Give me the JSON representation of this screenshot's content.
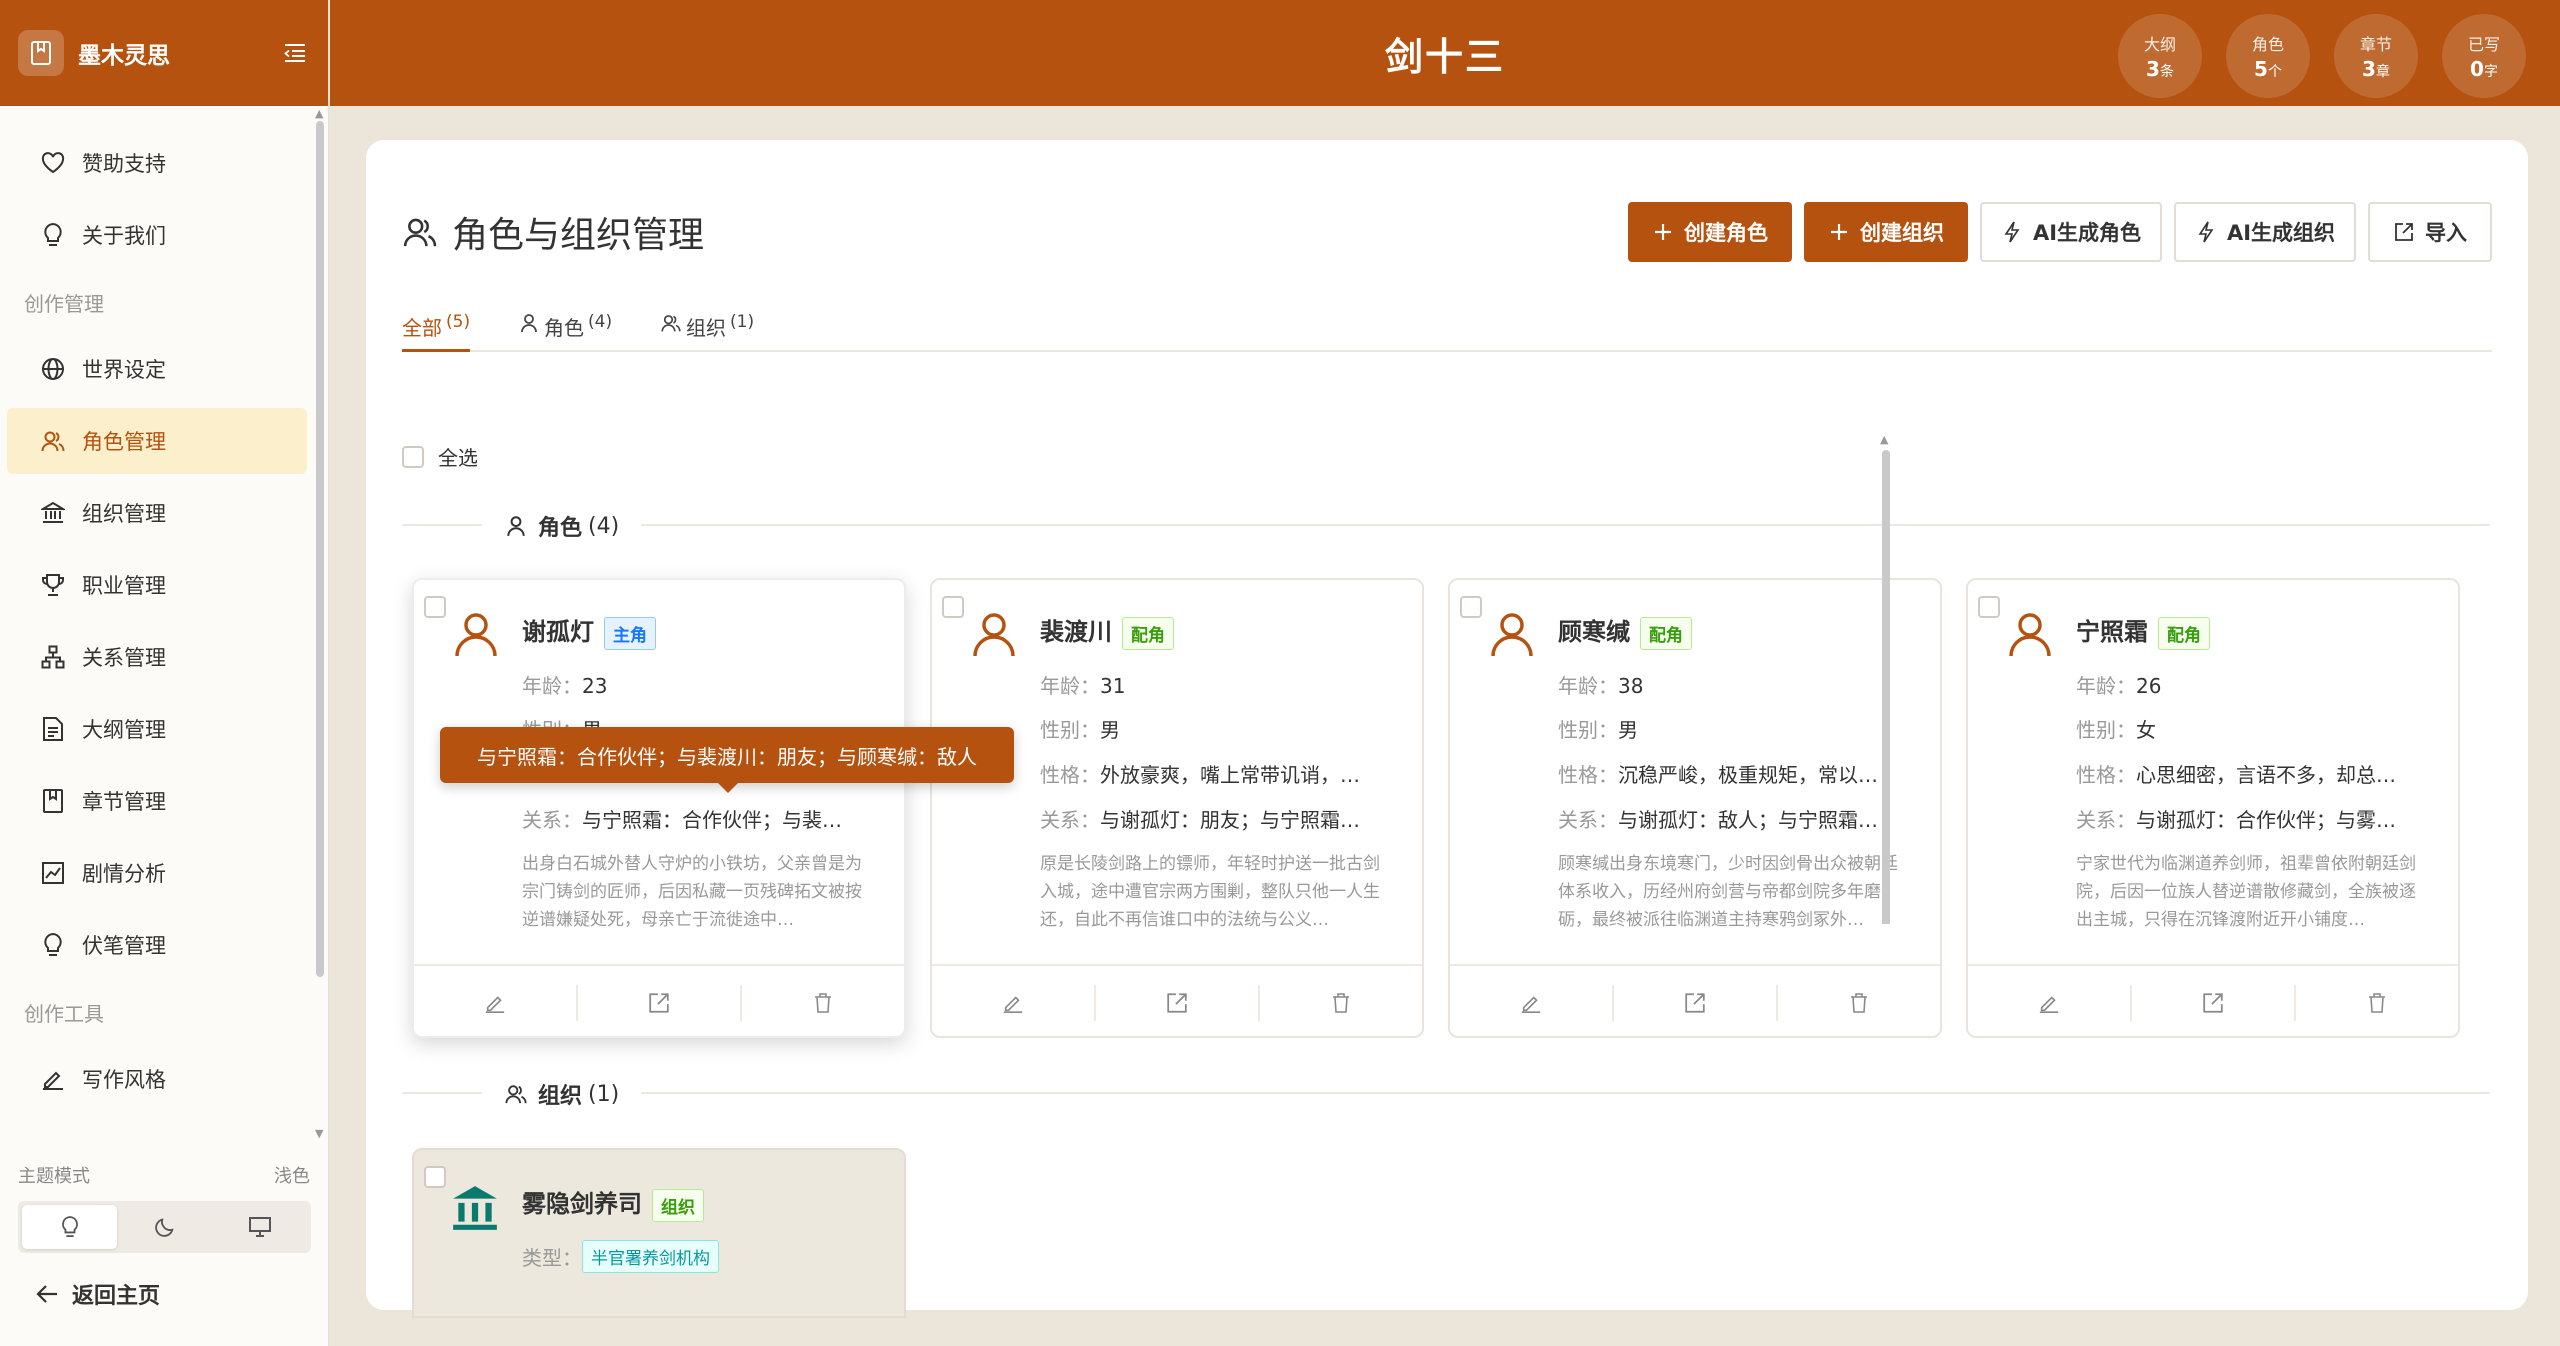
{
  "brand": {
    "name": "墨木灵思"
  },
  "header": {
    "title": "剑十三",
    "stats": [
      {
        "label": "大纲",
        "value": "3",
        "unit": "条"
      },
      {
        "label": "角色",
        "value": "5",
        "unit": "个"
      },
      {
        "label": "章节",
        "value": "3",
        "unit": "章"
      },
      {
        "label": "已写",
        "value": "0",
        "unit": "字"
      }
    ]
  },
  "sidebar": {
    "items": [
      {
        "label": "赞助支持",
        "icon": "heart-icon"
      },
      {
        "label": "关于我们",
        "icon": "bulb-icon"
      },
      {
        "label": "世界设定",
        "icon": "globe-icon"
      },
      {
        "label": "角色管理",
        "icon": "users-icon",
        "active": true
      },
      {
        "label": "组织管理",
        "icon": "bank-icon"
      },
      {
        "label": "职业管理",
        "icon": "trophy-icon"
      },
      {
        "label": "关系管理",
        "icon": "cluster-icon"
      },
      {
        "label": "大纲管理",
        "icon": "file-icon"
      },
      {
        "label": "章节管理",
        "icon": "book-icon"
      },
      {
        "label": "剧情分析",
        "icon": "chart-icon"
      },
      {
        "label": "伏笔管理",
        "icon": "bulb-icon"
      },
      {
        "label": "写作风格",
        "icon": "edit-icon"
      }
    ],
    "groups": [
      "创作管理",
      "创作工具"
    ],
    "theme_label": "主题模式",
    "theme_value": "浅色",
    "back_label": "返回主页"
  },
  "page": {
    "title": "角色与组织管理",
    "buttons": {
      "create_character": "创建角色",
      "create_org": "创建组织",
      "ai_character": "AI生成角色",
      "ai_org": "AI生成组织",
      "import": "导入"
    },
    "tabs": [
      {
        "label": "全部",
        "count": "(5)"
      },
      {
        "label": "角色",
        "count": "(4)"
      },
      {
        "label": "组织",
        "count": "(1)"
      }
    ],
    "select_all": "全选",
    "sections": {
      "characters": {
        "label": "角色",
        "count": "(4)"
      },
      "orgs": {
        "label": "组织",
        "count": "(1)"
      }
    }
  },
  "labels": {
    "age": "年龄：",
    "gender": "性别：",
    "personality": "性格：",
    "relation": "关系：",
    "type": "类型："
  },
  "characters": [
    {
      "name": "谢孤灯",
      "tag": "主角",
      "age": "23",
      "gender": "男",
      "personality": "",
      "relation": "与宁照霜：合作伙伴；与裴…",
      "desc": "出身白石城外替人守炉的小铁坊，父亲曾是为宗门铸剑的匠师，后因私藏一页残碑拓文被按逆谱嫌疑处死，母亲亡于流徙途中…"
    },
    {
      "name": "裴渡川",
      "tag": "配角",
      "age": "31",
      "gender": "男",
      "personality": "外放豪爽，嘴上常带讥诮，…",
      "relation": "与谢孤灯：朋友；与宁照霜…",
      "desc": "原是长陵剑路上的镖师，年轻时护送一批古剑入城，途中遭官宗两方围剿，整队只他一人生还，自此不再信谁口中的法统与公义…"
    },
    {
      "name": "顾寒缄",
      "tag": "配角",
      "age": "38",
      "gender": "男",
      "personality": "沉稳严峻，极重规矩，常以…",
      "relation": "与谢孤灯：敌人；与宁照霜…",
      "desc": "顾寒缄出身东境寒门，少时因剑骨出众被朝廷体系收入，历经州府剑营与帝都剑院多年磨砺，最终被派往临渊道主持寒鸦剑冢外…"
    },
    {
      "name": "宁照霜",
      "tag": "配角",
      "age": "26",
      "gender": "女",
      "personality": "心思细密，言语不多，却总…",
      "relation": "与谢孤灯：合作伙伴；与雾…",
      "desc": "宁家世代为临渊道养剑师，祖辈曾依附朝廷剑院，后因一位族人替逆谱散修藏剑，全族被逐出主城，只得在沉锋渡附近开小铺度…"
    }
  ],
  "organizations": [
    {
      "name": "雾隐剑养司",
      "tag": "组织",
      "type": "半官署养剑机构"
    }
  ],
  "tooltip": "与宁照霜：合作伙伴；与裴渡川：朋友；与顾寒缄：敌人",
  "colors": {
    "brand": "#b5520f",
    "active_bg": "#fcefcc",
    "org_icon": "#0b7a6e"
  }
}
